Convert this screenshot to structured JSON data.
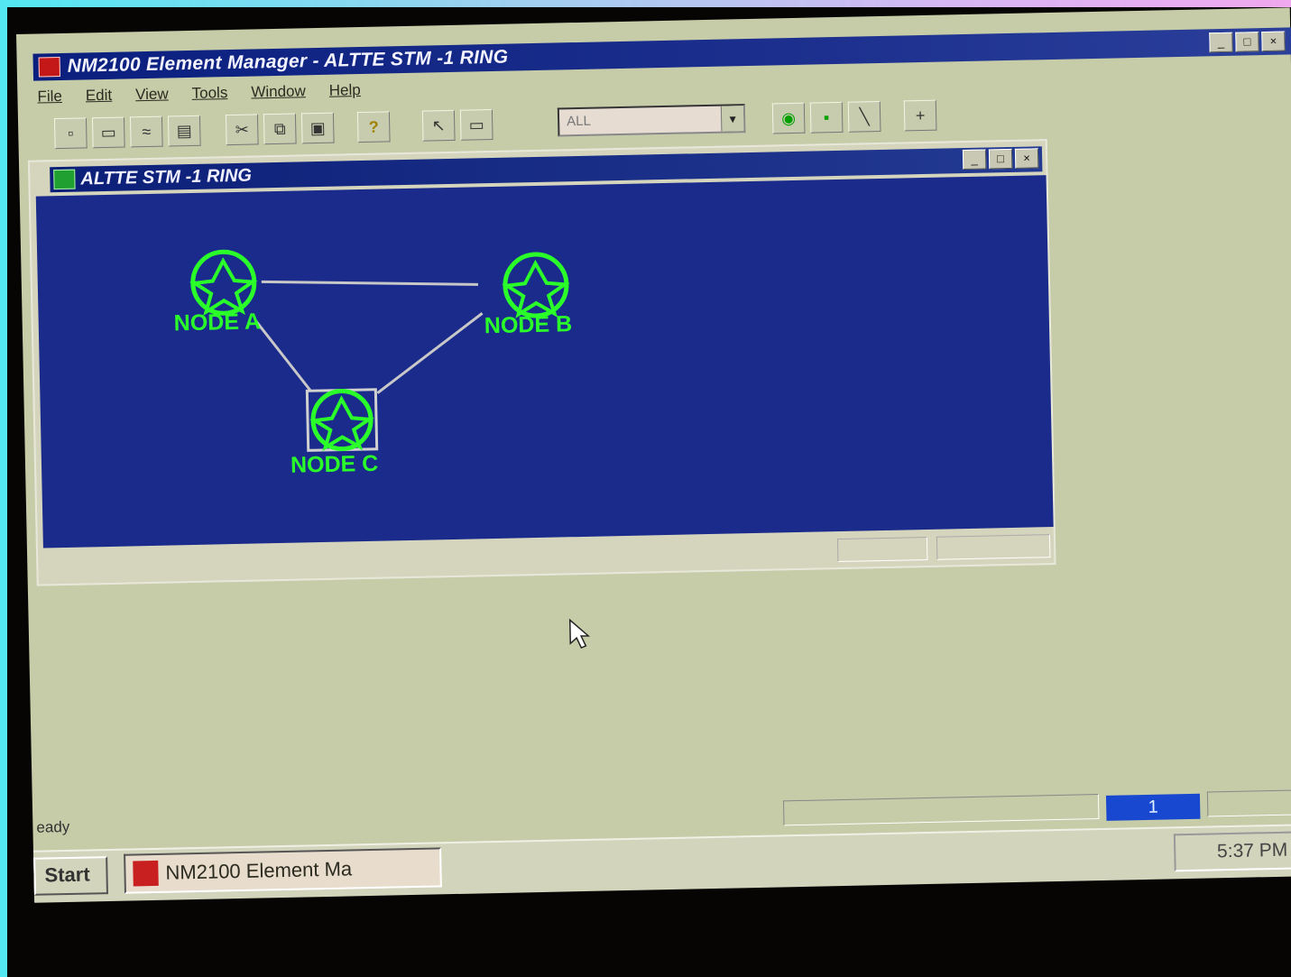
{
  "app": {
    "title": "NM2100 Element Manager - ALTTE STM -1 RING",
    "menu": [
      "File",
      "Edit",
      "View",
      "Tools",
      "Window",
      "Help"
    ],
    "combo_value": "ALL"
  },
  "child_window": {
    "title": "ALTTE STM -1 RING",
    "nodes": [
      {
        "id": "a",
        "label": "NODE A"
      },
      {
        "id": "b",
        "label": "NODE B"
      },
      {
        "id": "c",
        "label": "NODE C",
        "selected": true
      }
    ],
    "links": [
      [
        "a",
        "b"
      ],
      [
        "a",
        "c"
      ],
      [
        "b",
        "c"
      ]
    ]
  },
  "status": {
    "text": "eady",
    "page": "1"
  },
  "taskbar": {
    "start_label": "Start",
    "task_label": "NM2100 Element Ma",
    "clock": "5:37 PM"
  },
  "colors": {
    "canvas": "#1a2b8c",
    "node": "#2aff2a",
    "titlebar": "#0a1f7e"
  }
}
